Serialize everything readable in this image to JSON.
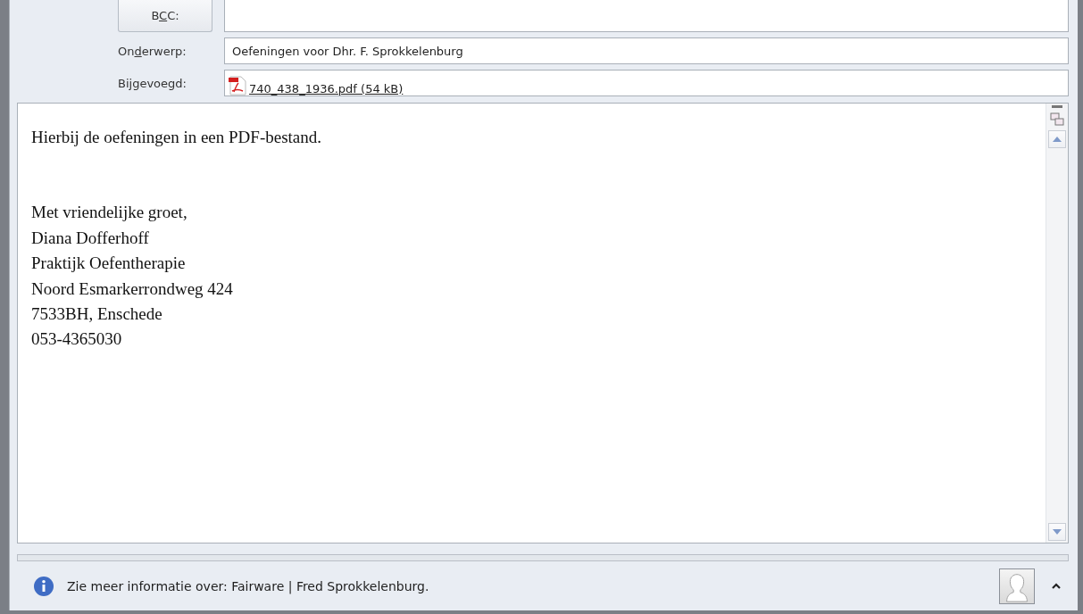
{
  "header": {
    "bcc_button": {
      "before": "B",
      "key": "C",
      "after": "C:"
    },
    "subject": {
      "label_before": "On",
      "label_key": "d",
      "label_after": "erwerp:",
      "value": "Oefeningen voor Dhr. F. Sprokkelenburg"
    },
    "attachment": {
      "label": "Bijgevoegd:",
      "file": "740_438_1936.pdf (54 kB)"
    }
  },
  "body": {
    "intro": "Hierbij de oefeningen in een PDF-bestand.",
    "signature": [
      "Met vriendelijke groet,",
      "Diana Dofferhoff",
      "Praktijk Oefentherapie",
      "Noord Esmarkerrondweg 424",
      "7533BH, Enschede",
      "053-4365030"
    ]
  },
  "status_bar": {
    "text": "Zie meer informatie over: Fairware | Fred Sprokkelenburg.",
    "expanded": false
  }
}
